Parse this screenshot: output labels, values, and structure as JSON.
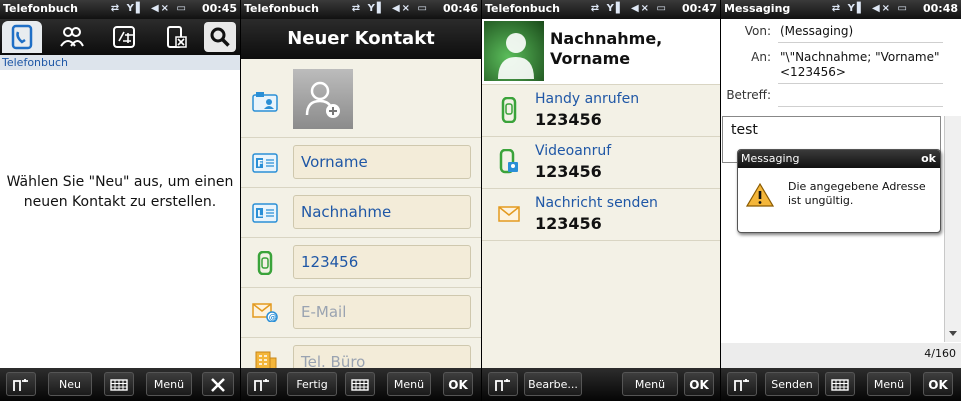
{
  "panel1": {
    "status": {
      "title": "Telefonbuch",
      "time": "00:45"
    },
    "breadcrumb": "Telefonbuch",
    "empty_message": "Wählen Sie \"Neu\" aus, um einen neuen Kontakt zu erstellen.",
    "softkeys": {
      "new": "Neu",
      "menu": "Menü"
    }
  },
  "panel2": {
    "status": {
      "title": "Telefonbuch",
      "time": "00:46"
    },
    "header": "Neuer Kontakt",
    "fields": {
      "first_name": "Vorname",
      "last_name": "Nachnahme",
      "phone": "123456",
      "email_placeholder": "E-Mail",
      "office_placeholder": "Tel. Büro"
    },
    "softkeys": {
      "done": "Fertig",
      "menu": "Menü",
      "ok": "OK"
    }
  },
  "panel3": {
    "status": {
      "title": "Telefonbuch",
      "time": "00:47"
    },
    "contact_name_line1": "Nachnahme,",
    "contact_name_line2": "Vorname",
    "actions": [
      {
        "label": "Handy anrufen",
        "value": "123456"
      },
      {
        "label": "Videoanruf",
        "value": "123456"
      },
      {
        "label": "Nachricht senden",
        "value": "123456"
      }
    ],
    "softkeys": {
      "edit": "Bearbe...",
      "menu": "Menü",
      "ok": "OK"
    }
  },
  "panel4": {
    "status": {
      "title": "Messaging",
      "time": "00:48"
    },
    "from_label": "Von:",
    "from_value": "(Messaging)",
    "to_label": "An:",
    "to_value": "\"\\\"Nachnahme; \"Vorname\" <123456>",
    "subject_label": "Betreff:",
    "body": "test",
    "counter": "4/160",
    "dialog": {
      "title": "Messaging",
      "ok": "ok",
      "message": "Die angegebene Adresse ist ungültig."
    },
    "softkeys": {
      "send": "Senden",
      "menu": "Menü",
      "ok": "OK"
    }
  }
}
